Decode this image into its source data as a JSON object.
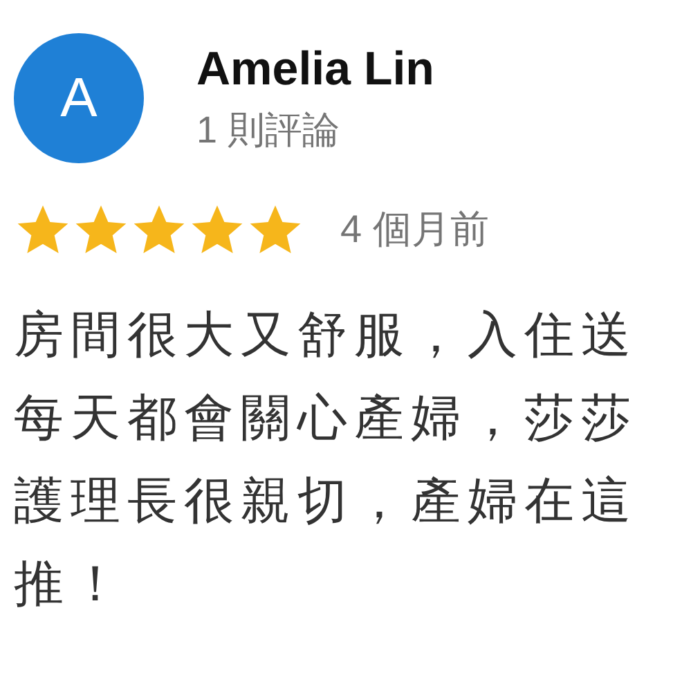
{
  "review": {
    "avatar_letter": "A",
    "author": "Amelia Lin",
    "review_count": "1 則評論",
    "stars": 5,
    "time": "4 個月前",
    "lines": [
      "房間很大又舒服，入住送",
      "每天都會關心產婦，莎莎",
      "護理長很親切，產婦在這",
      "推！"
    ]
  }
}
